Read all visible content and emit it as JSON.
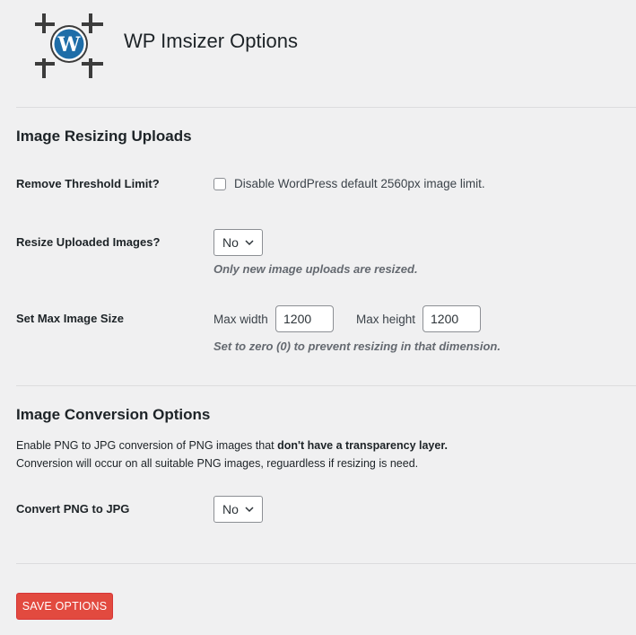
{
  "header": {
    "title": "WP Imsizer Options",
    "logo_icon": "wordpress-crop-icon",
    "logo_color": "#3c3c3c",
    "wp_blue": "#1e6da8"
  },
  "sections": {
    "resizing": {
      "title": "Image Resizing Uploads",
      "threshold": {
        "label": "Remove Threshold Limit?",
        "checkbox_label": "Disable WordPress default 2560px image limit.",
        "checked": false
      },
      "resize_uploaded": {
        "label": "Resize Uploaded Images?",
        "selected": "No",
        "description": "Only new image uploads are resized."
      },
      "max_size": {
        "label": "Set Max Image Size",
        "width_label": "Max width",
        "width_value": "1200",
        "height_label": "Max height",
        "height_value": "1200",
        "description": "Set to zero (0) to prevent resizing in that dimension."
      }
    },
    "conversion": {
      "title": "Image Conversion Options",
      "intro_part1": "Enable PNG to JPG conversion of PNG images that ",
      "intro_bold": "don't have a transparency layer",
      "intro_end": ".",
      "intro_line2": "Conversion will occur on all suitable PNG images, reguardless if resizing is need.",
      "convert": {
        "label": "Convert PNG to JPG",
        "selected": "No"
      }
    }
  },
  "footer": {
    "save_label": "SAVE OPTIONS",
    "save_color": "#e24a3f"
  }
}
